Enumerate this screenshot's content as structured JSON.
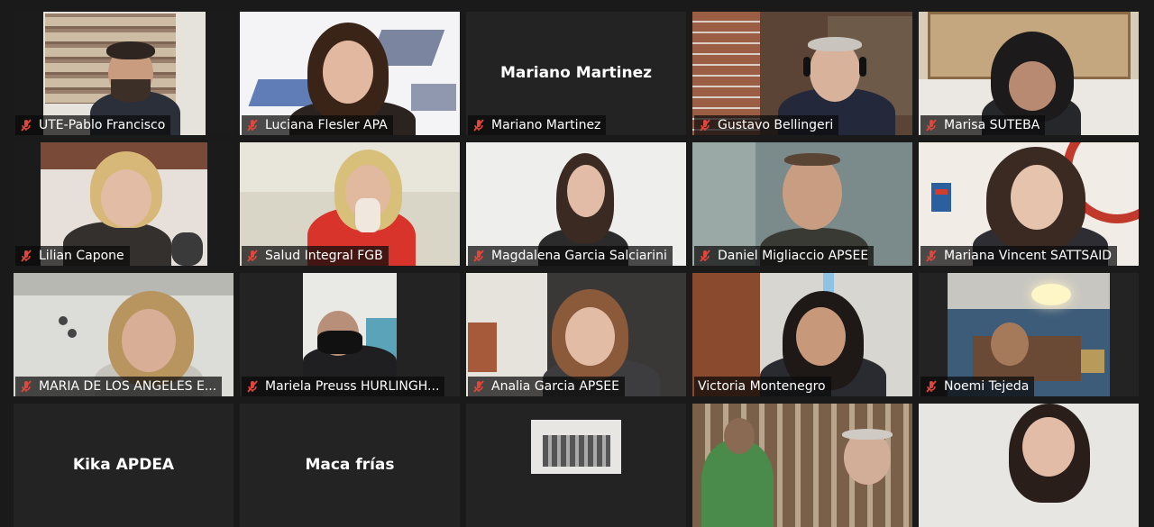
{
  "meeting": {
    "accent_color": "#c8d94a",
    "muted_icon": "microphone-muted-icon",
    "participants": [
      {
        "name": "UTE-Pablo Francisco",
        "muted": true,
        "video": true
      },
      {
        "name": "Luciana Flesler APA",
        "muted": true,
        "video": true
      },
      {
        "name": "Mariano Martinez",
        "muted": true,
        "video": false,
        "display_name": "Mariano Martinez"
      },
      {
        "name": "Gustavo Bellingeri",
        "muted": true,
        "video": true
      },
      {
        "name": "Marisa SUTEBA",
        "muted": true,
        "video": true
      },
      {
        "name": "Lilian Capone",
        "muted": true,
        "video": true
      },
      {
        "name": "Salud Integral FGB",
        "muted": true,
        "video": true
      },
      {
        "name": "Magdalena Garcia Salciarini",
        "muted": true,
        "video": true
      },
      {
        "name": "Daniel Migliaccio APSEE",
        "muted": true,
        "video": true
      },
      {
        "name": "Mariana Vincent SATTSAID",
        "muted": true,
        "video": true
      },
      {
        "name": "MARIA DE LOS ANGELES E...",
        "muted": true,
        "video": true
      },
      {
        "name": "Mariela Preuss HURLINGH...",
        "muted": true,
        "video": true
      },
      {
        "name": "Analia Garcia APSEE",
        "muted": true,
        "video": true
      },
      {
        "name": "Victoria Montenegro",
        "muted": false,
        "video": true,
        "active_speaker": true
      },
      {
        "name": "Noemi Tejeda",
        "muted": true,
        "video": true
      },
      {
        "name": "Kika APDEA",
        "muted": true,
        "video": false,
        "display_name": "Kika APDEA"
      },
      {
        "name": "Maca frías",
        "muted": true,
        "video": false,
        "display_name": "Maca frías"
      },
      {
        "name": "",
        "muted": true,
        "video": true
      },
      {
        "name": "",
        "muted": true,
        "video": true
      },
      {
        "name": "",
        "muted": true,
        "video": true
      }
    ]
  }
}
